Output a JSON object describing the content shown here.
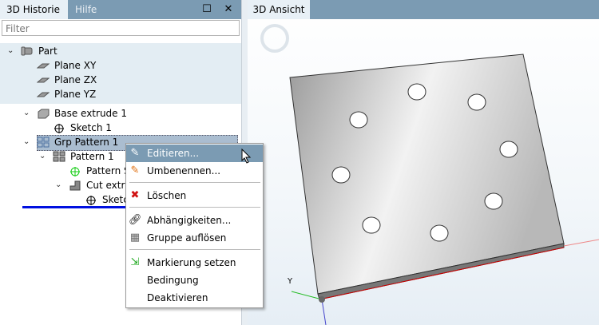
{
  "left_panel": {
    "tabs": [
      "3D Historie",
      "Hilfe"
    ],
    "filter_placeholder": "Filter"
  },
  "tree": [
    {
      "label": "Part",
      "icon": "part-icon"
    },
    {
      "label": "Plane XY",
      "icon": "plane-icon"
    },
    {
      "label": "Plane ZX",
      "icon": "plane-icon"
    },
    {
      "label": "Plane YZ",
      "icon": "plane-icon"
    },
    {
      "label": "Base extrude 1",
      "icon": "extrude-icon"
    },
    {
      "label": "Sketch 1",
      "icon": "sketch-icon"
    },
    {
      "label": "Grp Pattern 1",
      "icon": "group-pattern-icon"
    },
    {
      "label": "Pattern 1",
      "icon": "pattern-icon"
    },
    {
      "label": "Pattern S",
      "icon": "pattern-sketch-icon"
    },
    {
      "label": "Cut extru",
      "icon": "cut-extrude-icon"
    },
    {
      "label": "Sketc",
      "icon": "sketch-icon"
    }
  ],
  "view": {
    "tab": "3D Ansicht",
    "axis_label": "Y"
  },
  "context_menu": {
    "items": [
      "Editieren...",
      "Umbenennen...",
      "Löschen",
      "Abhängigkeiten...",
      "Gruppe auflösen",
      "Markierung setzen",
      "Bedingung",
      "Deaktivieren"
    ]
  },
  "colors": {
    "accent": "#7b9bb3",
    "selection": "#aabdd0"
  }
}
